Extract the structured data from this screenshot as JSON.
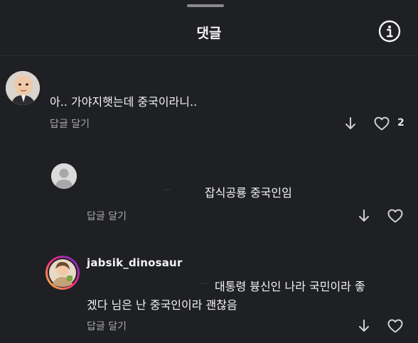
{
  "sheet": {
    "title": "댓글"
  },
  "comments": [
    {
      "text": "아.. 가야지햇는데 중국이라니..",
      "reply_label": "답글 달기",
      "like_count": "2"
    },
    {
      "text": "잡식공룡 중국인임",
      "reply_label": "답글 달기"
    },
    {
      "username": "jabsik_dinosaur",
      "text_line1": "대통령 븅신인 나라 국민이라 좋",
      "text_line2": "겠다 님은 난 중국인이라 괜찮음",
      "reply_label": "답글 달기"
    }
  ],
  "icons": {
    "info": "info-circle-icon",
    "dislike": "arrow-down-icon",
    "like": "heart-outline-icon"
  },
  "colors": {
    "background": "#1f2023",
    "text": "#f3f3f3",
    "muted": "#a8a8ad",
    "story_ring": "#e1306c"
  }
}
